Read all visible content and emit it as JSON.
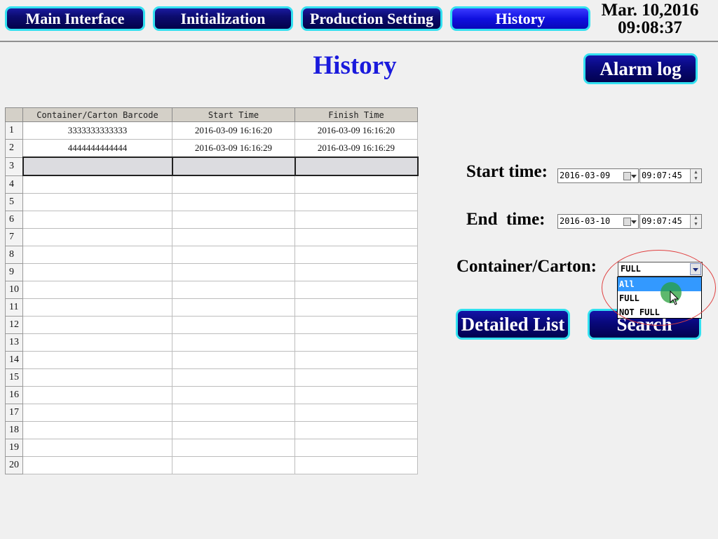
{
  "nav": {
    "main_interface": "Main Interface",
    "initialization": "Initialization",
    "production_setting": "Production Setting",
    "history": "History"
  },
  "datetime": {
    "date": "Mar. 10,2016",
    "time": "09:08:37"
  },
  "page_title": "History",
  "alarm_log_label": "Alarm log",
  "table": {
    "headers": [
      "Container/Carton Barcode",
      "Start Time",
      "Finish Time"
    ],
    "rows": [
      [
        "3333333333333",
        "2016-03-09 16:16:20",
        "2016-03-09 16:16:20"
      ],
      [
        "4444444444444",
        "2016-03-09 16:16:29",
        "2016-03-09 16:16:29"
      ],
      [
        "",
        "",
        ""
      ],
      [
        "",
        "",
        ""
      ],
      [
        "",
        "",
        ""
      ],
      [
        "",
        "",
        ""
      ],
      [
        "",
        "",
        ""
      ],
      [
        "",
        "",
        ""
      ],
      [
        "",
        "",
        ""
      ],
      [
        "",
        "",
        ""
      ],
      [
        "",
        "",
        ""
      ],
      [
        "",
        "",
        ""
      ],
      [
        "",
        "",
        ""
      ],
      [
        "",
        "",
        ""
      ],
      [
        "",
        "",
        ""
      ],
      [
        "",
        "",
        ""
      ],
      [
        "",
        "",
        ""
      ],
      [
        "",
        "",
        ""
      ],
      [
        "",
        "",
        ""
      ],
      [
        "",
        "",
        ""
      ]
    ],
    "row_numbers": [
      "1",
      "2",
      "3",
      "4",
      "5",
      "6",
      "7",
      "8",
      "9",
      "10",
      "11",
      "12",
      "13",
      "14",
      "15",
      "16",
      "17",
      "18",
      "19",
      "20"
    ],
    "selected_row": 3
  },
  "form": {
    "start_label": "Start time:",
    "start_date": "2016-03-09",
    "start_time": "09:07:45",
    "end_label": "End  time:",
    "end_date": "2016-03-10",
    "end_time": "09:07:45",
    "container_label": "Container/Carton:",
    "container_value": "FULL",
    "container_options": [
      "All",
      "FULL",
      "NOT FULL"
    ],
    "highlighted_option": "All"
  },
  "buttons": {
    "detailed_list": "Detailed List",
    "search": "Search"
  },
  "colors": {
    "accent_border": "#33e0f0",
    "title_blue": "#1a1adc",
    "button_navy": "#08087a",
    "highlight": "#3399ff",
    "annotation": "#e04040"
  }
}
